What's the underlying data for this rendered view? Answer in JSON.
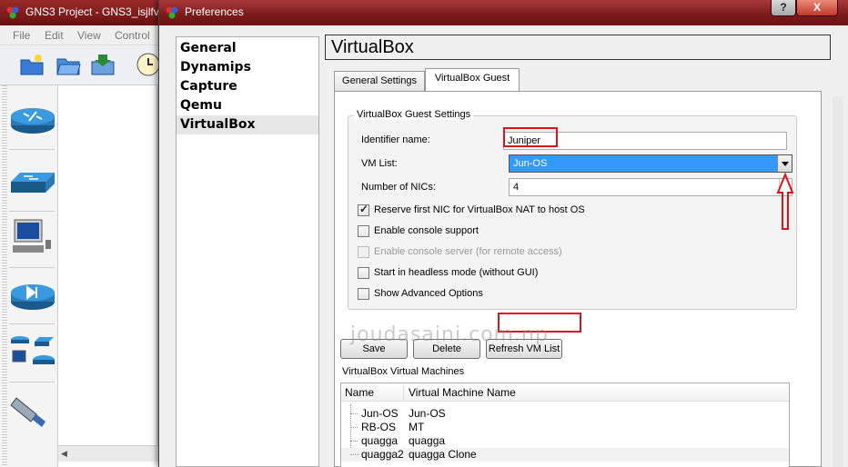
{
  "background_window": {
    "title": "GNS3 Project - GNS3_isjlfv",
    "menu": [
      "File",
      "Edit",
      "View",
      "Control"
    ]
  },
  "dialog": {
    "title": "Preferences",
    "help_label": "?",
    "close_label": "X"
  },
  "nav": {
    "items": [
      {
        "label": "General",
        "selected": false
      },
      {
        "label": "Dynamips",
        "selected": false
      },
      {
        "label": "Capture",
        "selected": false
      },
      {
        "label": "Qemu",
        "selected": false
      },
      {
        "label": "VirtualBox",
        "selected": true
      }
    ]
  },
  "section_title": "VirtualBox",
  "tabs": [
    {
      "label": "General Settings",
      "active": false
    },
    {
      "label": "VirtualBox Guest",
      "active": true
    }
  ],
  "guest_settings": {
    "group_title": "VirtualBox Guest Settings",
    "identifier_label": "Identifier name:",
    "identifier_value": "Juniper",
    "vm_list_label": "VM List:",
    "vm_list_value": "Jun-OS",
    "nics_label": "Number of NICs:",
    "nics_value": "4",
    "checkboxes": [
      {
        "label": "Reserve first NIC for VirtualBox NAT to host OS",
        "checked": true,
        "disabled": false
      },
      {
        "label": "Enable console support",
        "checked": false,
        "disabled": false
      },
      {
        "label": "Enable console server (for remote access)",
        "checked": false,
        "disabled": true
      },
      {
        "label": "Start in headless mode (without GUI)",
        "checked": false,
        "disabled": false
      },
      {
        "label": "Show Advanced Options",
        "checked": false,
        "disabled": false
      }
    ]
  },
  "buttons": {
    "save": "Save",
    "delete": "Delete",
    "refresh": "Refresh VM List"
  },
  "vm_table": {
    "label": "VirtualBox Virtual Machines",
    "columns": [
      "Name",
      "Virtual Machine Name"
    ],
    "rows": [
      {
        "name": "Jun-OS",
        "vm": "Jun-OS"
      },
      {
        "name": "RB-OS",
        "vm": "MT"
      },
      {
        "name": "quagga",
        "vm": "quagga"
      },
      {
        "name": "quagga2",
        "vm": "quagga Clone"
      }
    ]
  },
  "watermark": "joudasaini.com.np",
  "colors": {
    "highlight": "#e0121b",
    "selection": "#3399ff",
    "titlebar": "#7a1a1a"
  }
}
